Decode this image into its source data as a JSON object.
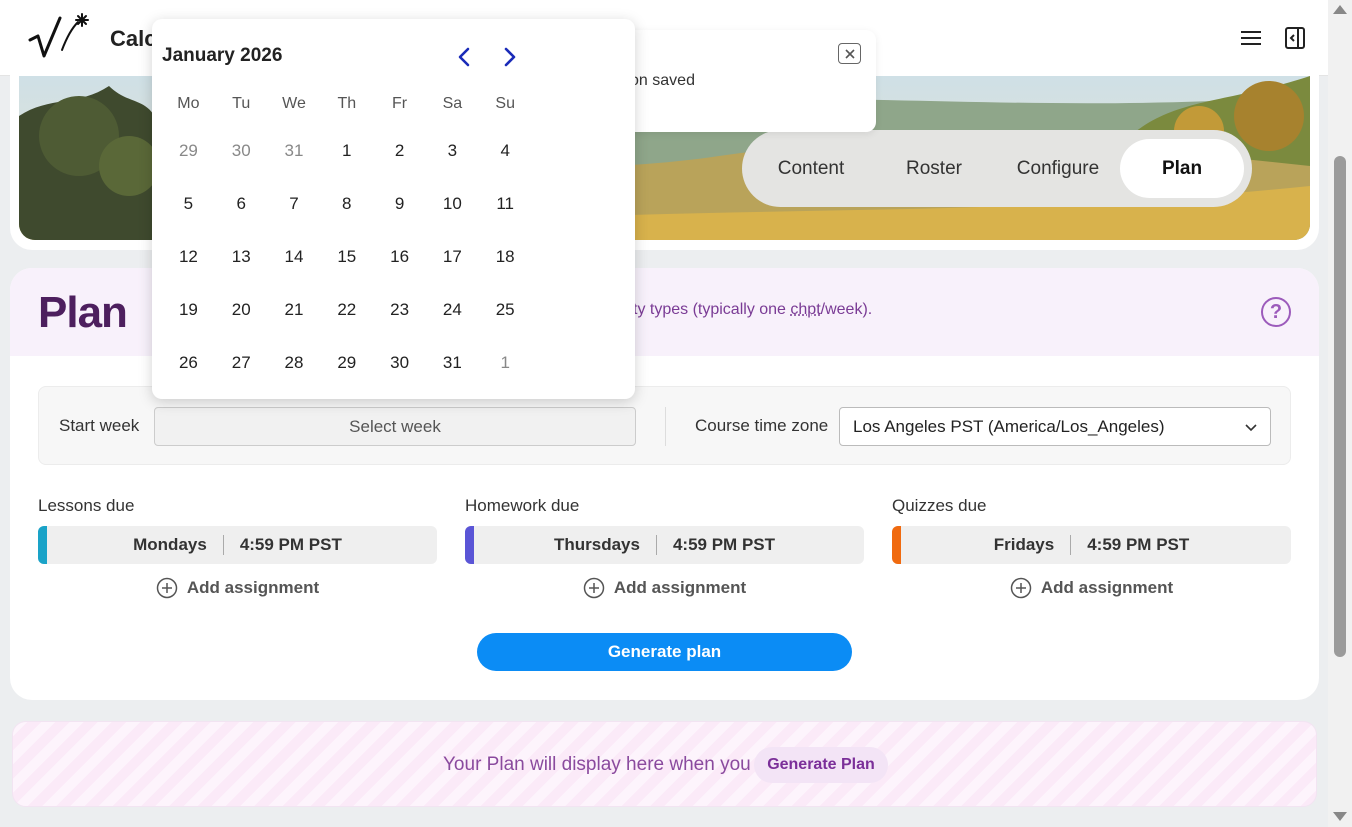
{
  "header": {
    "app_title": "Calc",
    "logo": "square-root-star-logo",
    "menu_icon": "hamburger-icon",
    "panel_icon": "panel-toggle-icon"
  },
  "toast": {
    "message": "guration saved",
    "close_icon": "close-icon"
  },
  "tabs": [
    {
      "label": "Content",
      "active": false
    },
    {
      "label": "Roster",
      "active": false
    },
    {
      "label": "Configure",
      "active": false
    },
    {
      "label": "Plan",
      "active": true
    }
  ],
  "plan": {
    "title": "Plan",
    "description_pre": "ty types (typically one ",
    "description_abbr": "chpt",
    "description_post": "/week).",
    "help_icon": "?",
    "start_week_label": "Start week",
    "start_week_placeholder": "Select week",
    "timezone_label": "Course time zone",
    "timezone_value": "Los Angeles PST (America/Los_Angeles)",
    "due": [
      {
        "label": "Lessons due",
        "day": "Mondays",
        "time": "4:59 PM PST",
        "color": "#1aa3c8",
        "add_label": "Add assignment"
      },
      {
        "label": "Homework due",
        "day": "Thursdays",
        "time": "4:59 PM PST",
        "color": "#5a55d6",
        "add_label": "Add assignment"
      },
      {
        "label": "Quizzes due",
        "day": "Fridays",
        "time": "4:59 PM PST",
        "color": "#f06a0f",
        "add_label": "Add assignment"
      }
    ],
    "generate_label": "Generate plan"
  },
  "banner": {
    "text": "Your Plan will display here when you",
    "button_label": "Generate Plan"
  },
  "calendar": {
    "month_label": "January 2026",
    "weekdays": [
      "Mo",
      "Tu",
      "We",
      "Th",
      "Fr",
      "Sa",
      "Su"
    ],
    "weeks": [
      [
        {
          "d": "29",
          "m": true
        },
        {
          "d": "30",
          "m": true
        },
        {
          "d": "31",
          "m": true
        },
        {
          "d": "1",
          "m": false
        },
        {
          "d": "2",
          "m": false
        },
        {
          "d": "3",
          "m": false
        },
        {
          "d": "4",
          "m": false
        }
      ],
      [
        {
          "d": "5",
          "m": false
        },
        {
          "d": "6",
          "m": false
        },
        {
          "d": "7",
          "m": false
        },
        {
          "d": "8",
          "m": false
        },
        {
          "d": "9",
          "m": false
        },
        {
          "d": "10",
          "m": false
        },
        {
          "d": "11",
          "m": false
        }
      ],
      [
        {
          "d": "12",
          "m": false
        },
        {
          "d": "13",
          "m": false
        },
        {
          "d": "14",
          "m": false
        },
        {
          "d": "15",
          "m": false
        },
        {
          "d": "16",
          "m": false
        },
        {
          "d": "17",
          "m": false
        },
        {
          "d": "18",
          "m": false
        }
      ],
      [
        {
          "d": "19",
          "m": false
        },
        {
          "d": "20",
          "m": false
        },
        {
          "d": "21",
          "m": false
        },
        {
          "d": "22",
          "m": false
        },
        {
          "d": "23",
          "m": false
        },
        {
          "d": "24",
          "m": false
        },
        {
          "d": "25",
          "m": false
        }
      ],
      [
        {
          "d": "26",
          "m": false
        },
        {
          "d": "27",
          "m": false
        },
        {
          "d": "28",
          "m": false
        },
        {
          "d": "29",
          "m": false
        },
        {
          "d": "30",
          "m": false
        },
        {
          "d": "31",
          "m": false
        },
        {
          "d": "1",
          "m": true
        }
      ]
    ],
    "nav_color": "#1a2bb8"
  }
}
